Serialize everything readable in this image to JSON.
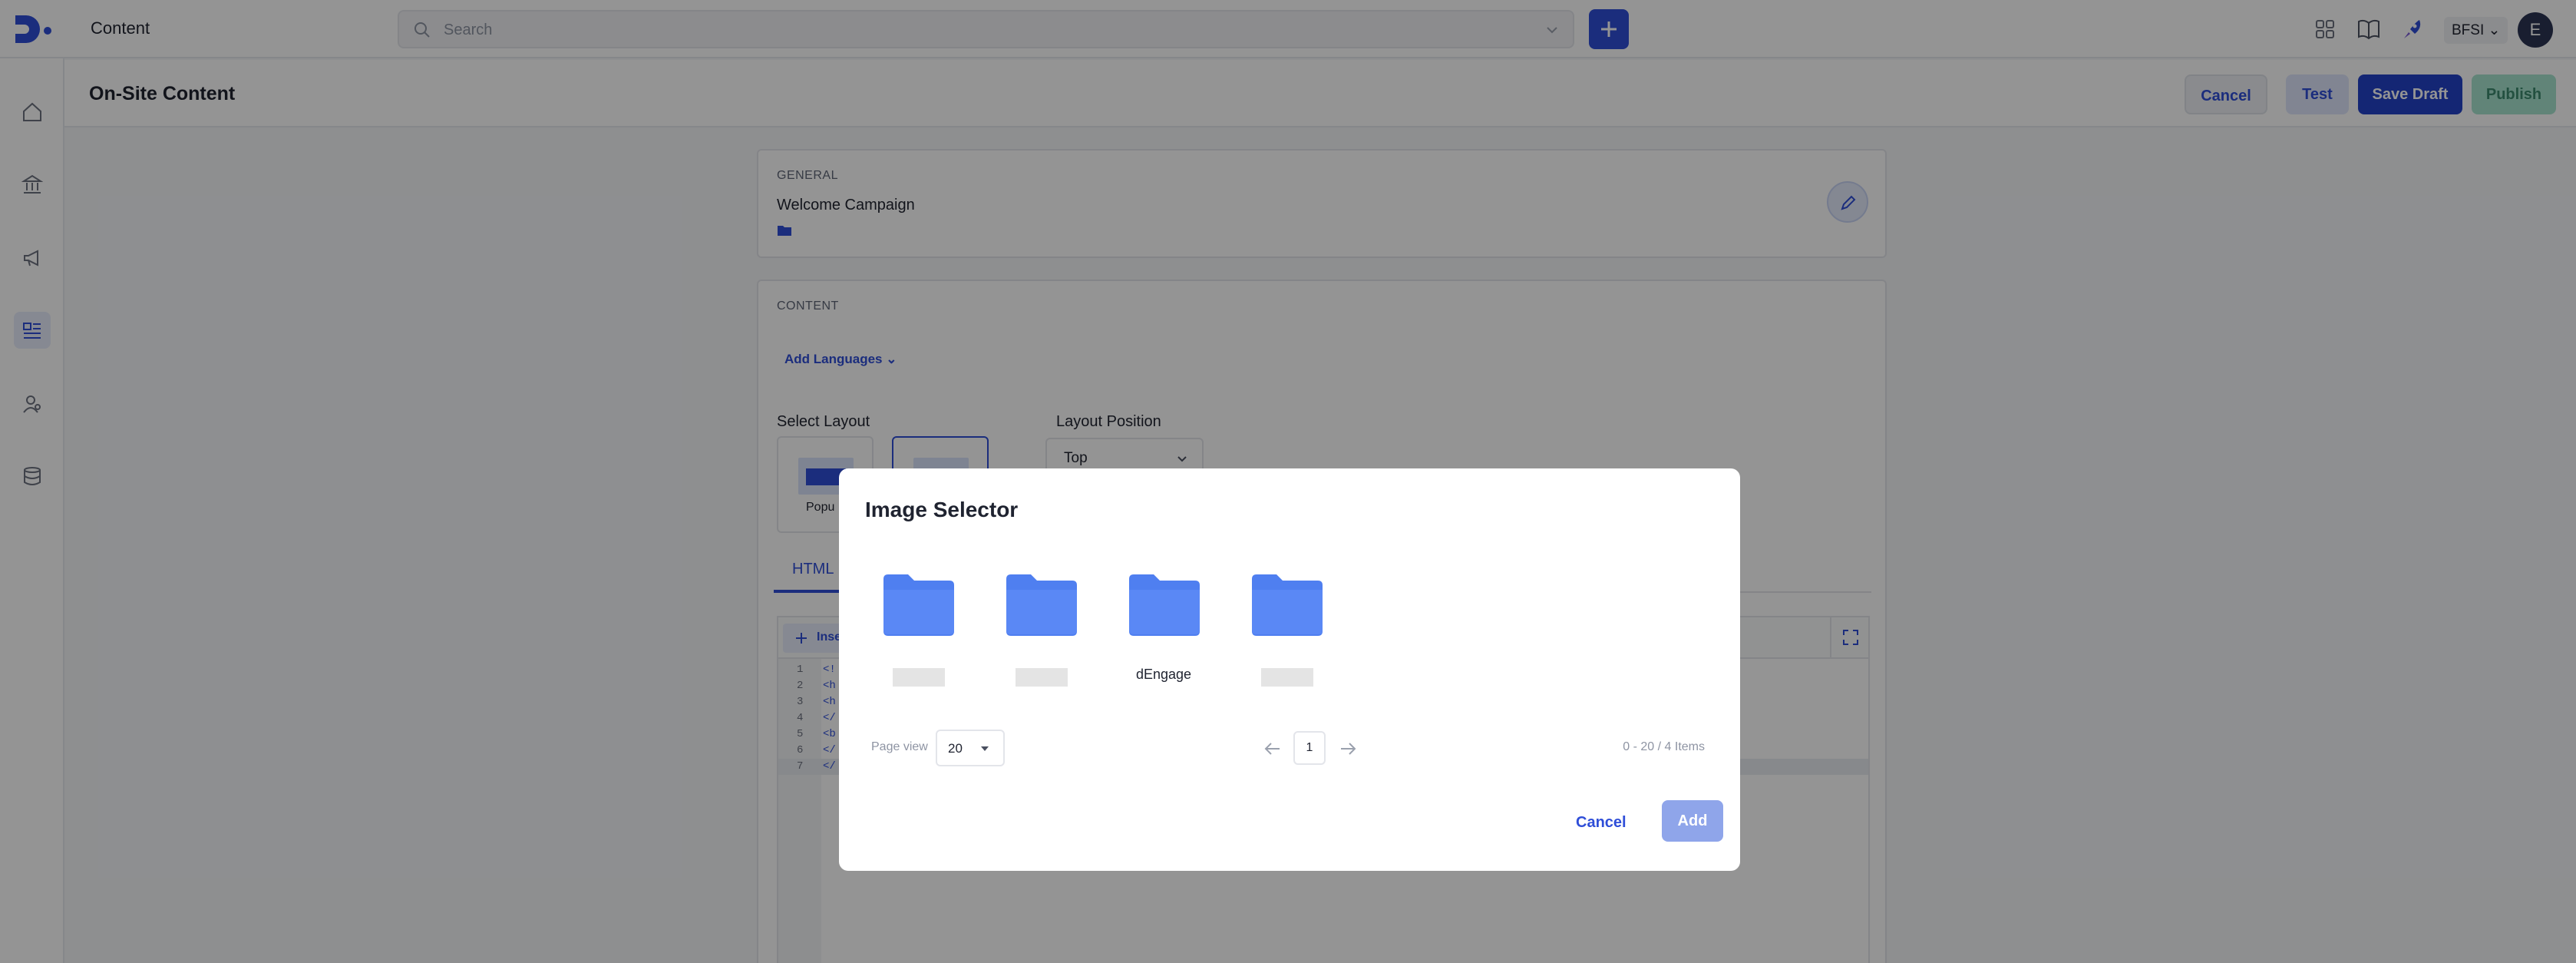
{
  "app": {
    "title": "Content",
    "org": "BFSI",
    "avatar_initial": "E"
  },
  "search": {
    "placeholder": "Search"
  },
  "topbar_icons": [
    "plus-icon",
    "apps-grid-icon",
    "book-icon",
    "rocket-icon"
  ],
  "sidebar": {
    "items": [
      "home-icon",
      "bank-icon",
      "megaphone-icon",
      "content-icon",
      "users-icon",
      "database-icon"
    ],
    "active": "content-icon"
  },
  "page": {
    "title": "On-Site Content"
  },
  "header_buttons": {
    "cancel": "Cancel",
    "test": "Test",
    "save_draft": "Save Draft",
    "publish": "Publish"
  },
  "general": {
    "label": "GENERAL",
    "name": "Welcome Campaign"
  },
  "content": {
    "label": "CONTENT",
    "add_languages": "Add Languages",
    "select_layout": "Select Layout",
    "layout_option_1": "Popu",
    "layout_position": "Layout Position",
    "layout_position_value": "Top",
    "tab_html": "HTML",
    "insert": "Inse",
    "code_lines": [
      {
        "n": "1",
        "t": "<!",
        "hl": false
      },
      {
        "n": "2",
        "t": "<h",
        "hl": false
      },
      {
        "n": "3",
        "t": "<h",
        "hl": false
      },
      {
        "n": "4",
        "t": "</",
        "hl": false
      },
      {
        "n": "5",
        "t": "<b",
        "hl": false
      },
      {
        "n": "6",
        "t": "</",
        "hl": false
      },
      {
        "n": "7",
        "t": "</",
        "hl": true
      }
    ]
  },
  "modal": {
    "title": "Image Selector",
    "folders": [
      {
        "name": "",
        "redacted": true
      },
      {
        "name": "",
        "redacted": true
      },
      {
        "name": "dEngage",
        "redacted": false
      },
      {
        "name": "",
        "redacted": true
      }
    ],
    "page_view_label": "Page view",
    "page_size": "20",
    "current_page": "1",
    "items_count": "0 - 20 / 4 Items",
    "cancel": "Cancel",
    "add": "Add"
  },
  "colors": {
    "accent": "#2f4ed8",
    "folder": "#4f7ff0",
    "publish_bg": "#a7e3cf"
  }
}
